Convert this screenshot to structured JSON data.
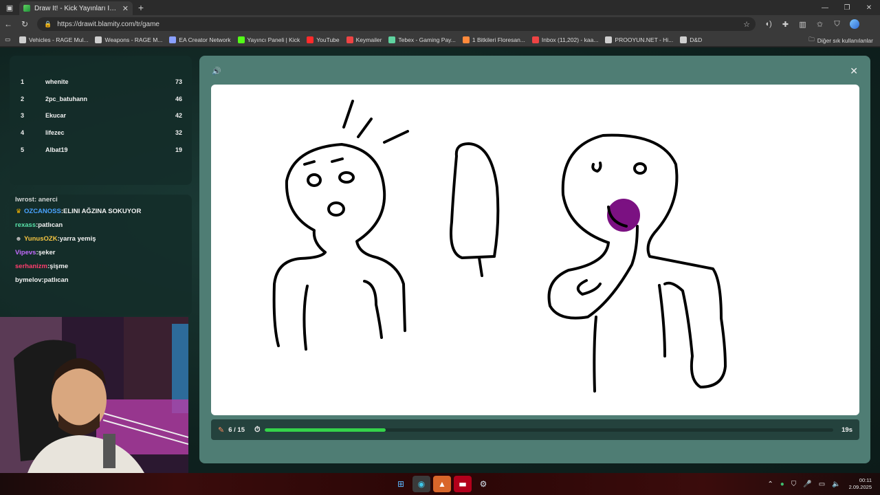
{
  "browser": {
    "tab_title": "Draw It! - Kick Yayınları İçin Çizim...",
    "tab_close": "✕",
    "new_tab": "+",
    "url": "https://drawit.blamity.com/tr/game",
    "bookmarks": [
      {
        "label": "Vehicles - RAGE Mul...",
        "color": "#cfcfcf"
      },
      {
        "label": "Weapons - RAGE M...",
        "color": "#cfcfcf"
      },
      {
        "label": "EA Creator Network",
        "color": "#8aa0ff"
      },
      {
        "label": "Yayıncı Paneli | Kick",
        "color": "#53fc18"
      },
      {
        "label": "YouTube",
        "color": "#ff2b2b"
      },
      {
        "label": "Keymailer",
        "color": "#e44"
      },
      {
        "label": "Tebex - Gaming Pay...",
        "color": "#5fd3a0"
      },
      {
        "label": "1 Bitkileri Floresan...",
        "color": "#ff8a3c"
      },
      {
        "label": "Inbox (11,202) - kaa...",
        "color": "#e44"
      },
      {
        "label": "PROOYUN.NET - Hi...",
        "color": "#cfcfcf"
      },
      {
        "label": "D&D",
        "color": "#cfcfcf"
      }
    ],
    "other_bookmarks": "Diğer sık kullanılanlar"
  },
  "leaderboard": [
    {
      "rank": "1",
      "name": "whenite",
      "score": "73"
    },
    {
      "rank": "2",
      "name": "2pc_batuhann",
      "score": "46"
    },
    {
      "rank": "3",
      "name": "Ekucar",
      "score": "42"
    },
    {
      "rank": "4",
      "name": "lifezec",
      "score": "32"
    },
    {
      "rank": "5",
      "name": "Albat19",
      "score": "19"
    }
  ],
  "chat": {
    "cut_line": "Iwrost: anerci",
    "messages": [
      {
        "user": "OZCANOSS",
        "text": ":ELINI AĞZINA SOKUYOR",
        "color": "#4aa3ff",
        "badge": "crown"
      },
      {
        "user": "rexass",
        "text": ":patlıcan",
        "color": "#58e0a8",
        "badge": ""
      },
      {
        "user": "YunusOZK",
        "text": ":yarra yemiş",
        "color": "#f5c542",
        "badge": "bot"
      },
      {
        "user": "Vipevs",
        "text": ":şeker",
        "color": "#c46bff",
        "badge": ""
      },
      {
        "user": "serhanizm",
        "text": ":şişme",
        "color": "#ff3d6e",
        "badge": ""
      },
      {
        "user": "bymelov",
        "text": ":patlıcan",
        "color": "#f2f2f2",
        "badge": ""
      }
    ]
  },
  "game": {
    "round": "6 / 15",
    "time_left": "19s",
    "time_progress": 0.213,
    "close": "✕",
    "sound": "🔊"
  },
  "taskbar": {
    "time": "00:11",
    "date": "2.09.2025"
  }
}
